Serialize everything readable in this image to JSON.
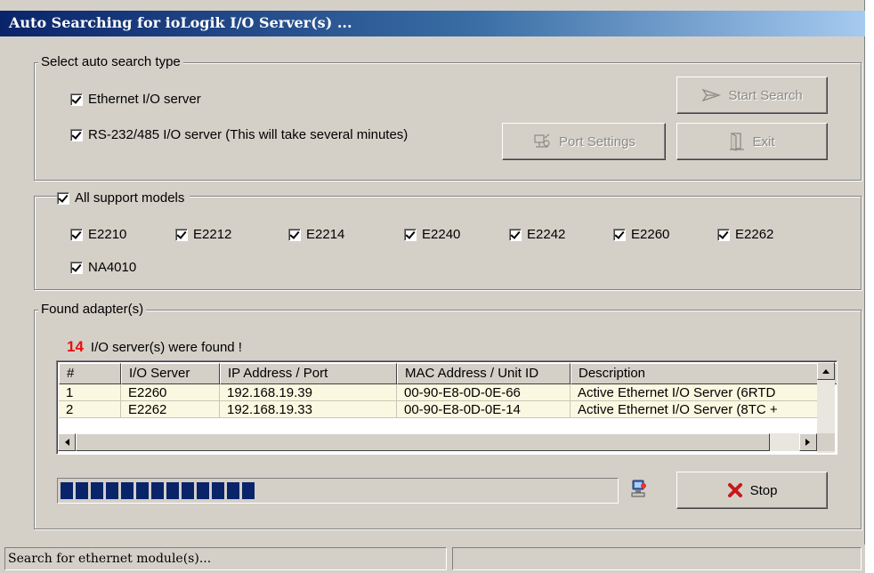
{
  "window": {
    "title": "Auto Searching for ioLogik I/O Server(s) ..."
  },
  "search_type": {
    "legend": "Select auto search type",
    "ethernet_label": "Ethernet I/O server",
    "ethernet_checked": true,
    "serial_label": "RS-232/485 I/O server (This will take several minutes)",
    "serial_checked": true
  },
  "buttons": {
    "start_search": "Start Search",
    "port_settings": "Port Settings",
    "exit": "Exit",
    "stop": "Stop"
  },
  "models": {
    "legend": "All support models",
    "all_checked": true,
    "items": [
      {
        "label": "E2210",
        "checked": true
      },
      {
        "label": "E2212",
        "checked": true
      },
      {
        "label": "E2214",
        "checked": true
      },
      {
        "label": "E2240",
        "checked": true
      },
      {
        "label": "E2242",
        "checked": true
      },
      {
        "label": "E2260",
        "checked": true
      },
      {
        "label": "E2262",
        "checked": true
      },
      {
        "label": "NA4010",
        "checked": true
      }
    ]
  },
  "found": {
    "legend": "Found adapter(s)",
    "count": "14",
    "message": "I/O server(s) were found !",
    "columns": [
      "#",
      "I/O Server",
      "IP Address / Port",
      "MAC Address / Unit ID",
      "Description"
    ],
    "rows": [
      [
        "1",
        "E2260",
        "192.168.19.39",
        "00-90-E8-0D-0E-66",
        "Active Ethernet I/O Server (6RTD"
      ],
      [
        "2",
        "E2262",
        "192.168.19.33",
        "00-90-E8-0D-0E-14",
        "Active Ethernet I/O Server (8TC +"
      ]
    ]
  },
  "progress": {
    "fraction": 0.35
  },
  "status": {
    "text": "Search for ethernet module(s)..."
  },
  "colors": {
    "title_start": "#0a246a",
    "title_end": "#a6caf0",
    "progress": "#0a246a",
    "count_text": "#e81010",
    "row_bg": "#fbf8e1"
  },
  "icons": [
    "check-icon",
    "start-search-arrow-icon",
    "port-settings-icon",
    "exit-door-icon",
    "network-computer-icon",
    "stop-x-icon",
    "scroll-arrow-icon"
  ]
}
